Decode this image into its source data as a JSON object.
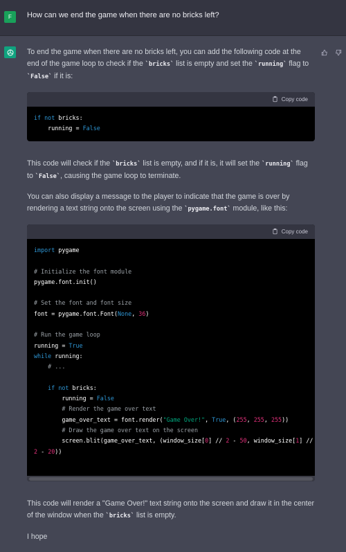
{
  "user": {
    "avatar_letter": "F",
    "message": "How can we end the game when there are no bricks left?"
  },
  "assistant": {
    "p1_a": "To end the game when there are no bricks left, you can add the following code at the end of the game loop to check if the ",
    "p1_code1": "`bricks`",
    "p1_b": " list is empty and set the ",
    "p1_code2": "`running`",
    "p1_c": " flag to ",
    "p1_code3": "`False`",
    "p1_d": " if it is:",
    "p2_a": "This code will check if the ",
    "p2_code1": "`bricks`",
    "p2_b": " list is empty, and if it is, it will set the ",
    "p2_code2": "`running`",
    "p2_c": " flag to ",
    "p2_code3": "`False`",
    "p2_d": ", causing the game loop to terminate.",
    "p3_a": "You can also display a message to the player to indicate that the game is over by rendering a text string onto the screen using the ",
    "p3_code1": "`pygame.font`",
    "p3_b": " module, like this:",
    "p4_a": "This code will render a \"Game Over!\" text string onto the screen and draw it in the center of the window when the ",
    "p4_code1": "`bricks`",
    "p4_b": " list is empty.",
    "p5": "I hope"
  },
  "code_blocks": {
    "copy_label": "Copy code"
  },
  "icons": {
    "thumbs_up": "thumbs-up-icon",
    "thumbs_down": "thumbs-down-icon",
    "clipboard": "clipboard-icon",
    "assistant_logo": "openai-logo-icon"
  },
  "colors": {
    "background": "#444654",
    "user_row": "#343541",
    "accent": "#10a37f",
    "code_bg": "#000000"
  }
}
